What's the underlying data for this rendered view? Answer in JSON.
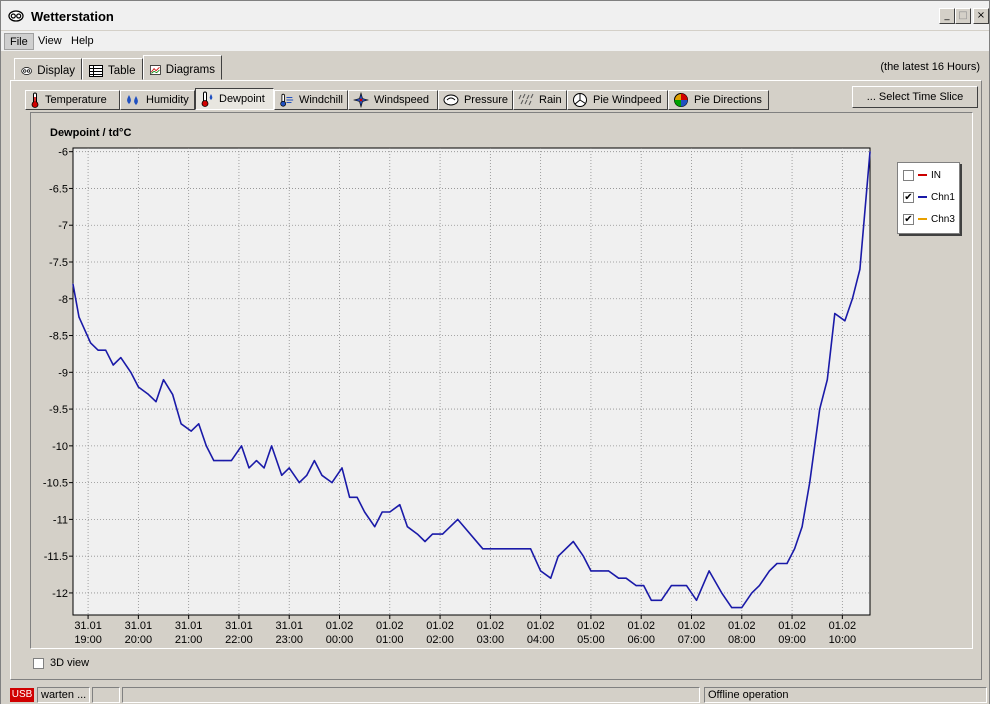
{
  "window": {
    "title": "Wetterstation"
  },
  "menu": {
    "file": "File",
    "view": "View",
    "help": "Help"
  },
  "main_tabs": [
    {
      "label": "Display",
      "icon": "display-icon"
    },
    {
      "label": "Table",
      "icon": "table-icon"
    },
    {
      "label": "Diagrams",
      "icon": "diagram-icon"
    }
  ],
  "range_label": "(the latest 16 Hours)",
  "sub_tabs": [
    {
      "label": "Temperature",
      "icon": "thermometer-icon"
    },
    {
      "label": "Humidity",
      "icon": "humidity-icon"
    },
    {
      "label": "Dewpoint",
      "icon": "dewpoint-icon"
    },
    {
      "label": "Windchill",
      "icon": "windchill-icon"
    },
    {
      "label": "Windspeed",
      "icon": "windspeed-icon"
    },
    {
      "label": "Pressure",
      "icon": "pressure-icon"
    },
    {
      "label": "Rain",
      "icon": "rain-icon"
    },
    {
      "label": "Pie Windpeed",
      "icon": "pie-icon"
    },
    {
      "label": "Pie Directions",
      "icon": "compass-icon"
    }
  ],
  "select_time_slice": "... Select Time Slice",
  "view3d_label": "3D view",
  "status": {
    "usb": "USB",
    "state": "warten ...",
    "mode": "Offline operation"
  },
  "colors": {
    "series_chn1": "#1a1aa8",
    "series_in": "#cc0000",
    "series_chn3": "#e8a000",
    "plot_bg": "#f0f0f0",
    "grid": "#8c8c8c"
  },
  "chart_data": {
    "type": "line",
    "title": "Dewpoint / td°C",
    "ylim": [
      -12.3,
      -5.95
    ],
    "yticks": [
      -6,
      -6.5,
      -7,
      -7.5,
      -8,
      -8.5,
      -9,
      -9.5,
      -10,
      -10.5,
      -11,
      -11.5,
      -12
    ],
    "xlim": [
      0,
      15.85
    ],
    "xticks": [
      {
        "x": 0.3,
        "date": "31.01",
        "time": "19:00"
      },
      {
        "x": 1.3,
        "date": "31.01",
        "time": "20:00"
      },
      {
        "x": 2.3,
        "date": "31.01",
        "time": "21:00"
      },
      {
        "x": 3.3,
        "date": "31.01",
        "time": "22:00"
      },
      {
        "x": 4.3,
        "date": "31.01",
        "time": "23:00"
      },
      {
        "x": 5.3,
        "date": "01.02",
        "time": "00:00"
      },
      {
        "x": 6.3,
        "date": "01.02",
        "time": "01:00"
      },
      {
        "x": 7.3,
        "date": "01.02",
        "time": "02:00"
      },
      {
        "x": 8.3,
        "date": "01.02",
        "time": "03:00"
      },
      {
        "x": 9.3,
        "date": "01.02",
        "time": "04:00"
      },
      {
        "x": 10.3,
        "date": "01.02",
        "time": "05:00"
      },
      {
        "x": 11.3,
        "date": "01.02",
        "time": "06:00"
      },
      {
        "x": 12.3,
        "date": "01.02",
        "time": "07:00"
      },
      {
        "x": 13.3,
        "date": "01.02",
        "time": "08:00"
      },
      {
        "x": 14.3,
        "date": "01.02",
        "time": "09:00"
      },
      {
        "x": 15.3,
        "date": "01.02",
        "time": "10:00"
      }
    ],
    "grid": true,
    "legend": {
      "position": "top-right"
    },
    "series": [
      {
        "name": "IN",
        "checked": false,
        "color": "#cc0000",
        "x": [],
        "y": []
      },
      {
        "name": "Chn1",
        "checked": true,
        "color": "#1a1aa8",
        "x": [
          0,
          0.12,
          0.35,
          0.5,
          0.65,
          0.8,
          0.95,
          1.15,
          1.3,
          1.5,
          1.65,
          1.8,
          1.98,
          2.15,
          2.35,
          2.5,
          2.65,
          2.8,
          3.0,
          3.15,
          3.35,
          3.5,
          3.65,
          3.8,
          3.95,
          4.15,
          4.3,
          4.5,
          4.65,
          4.8,
          4.95,
          5.15,
          5.35,
          5.5,
          5.65,
          5.8,
          6.0,
          6.15,
          6.3,
          6.5,
          6.65,
          6.85,
          7.0,
          7.15,
          7.35,
          7.65,
          8.15,
          8.6,
          8.8,
          8.95,
          9.1,
          9.3,
          9.5,
          9.65,
          9.95,
          10.15,
          10.3,
          10.5,
          10.65,
          10.85,
          11.0,
          11.2,
          11.35,
          11.5,
          11.7,
          11.9,
          12.05,
          12.2,
          12.4,
          12.65,
          12.9,
          13.1,
          13.3,
          13.5,
          13.65,
          13.85,
          14.0,
          14.2,
          14.35,
          14.5,
          14.65,
          14.85,
          15.0,
          15.15,
          15.35,
          15.5,
          15.65,
          15.85
        ],
        "y": [
          -7.8,
          -8.25,
          -8.6,
          -8.7,
          -8.7,
          -8.9,
          -8.8,
          -9.0,
          -9.2,
          -9.3,
          -9.4,
          -9.1,
          -9.3,
          -9.7,
          -9.8,
          -9.7,
          -10.0,
          -10.2,
          -10.2,
          -10.2,
          -10.0,
          -10.3,
          -10.2,
          -10.3,
          -10.0,
          -10.4,
          -10.3,
          -10.5,
          -10.4,
          -10.2,
          -10.4,
          -10.5,
          -10.3,
          -10.7,
          -10.7,
          -10.9,
          -11.1,
          -10.9,
          -10.9,
          -10.8,
          -11.1,
          -11.2,
          -11.3,
          -11.2,
          -11.2,
          -11.0,
          -11.4,
          -11.4,
          -11.4,
          -11.4,
          -11.4,
          -11.7,
          -11.8,
          -11.5,
          -11.3,
          -11.5,
          -11.7,
          -11.7,
          -11.7,
          -11.8,
          -11.8,
          -11.9,
          -11.9,
          -12.1,
          -12.1,
          -11.9,
          -11.9,
          -11.9,
          -12.1,
          -11.7,
          -12.0,
          -12.2,
          -12.2,
          -12.0,
          -11.9,
          -11.7,
          -11.6,
          -11.6,
          -11.4,
          -11.1,
          -10.5,
          -9.5,
          -9.1,
          -8.2,
          -8.3,
          -8.0,
          -7.6,
          -6.0
        ]
      },
      {
        "name": "Chn3",
        "checked": true,
        "color": "#e8a000",
        "x": [],
        "y": []
      }
    ]
  }
}
